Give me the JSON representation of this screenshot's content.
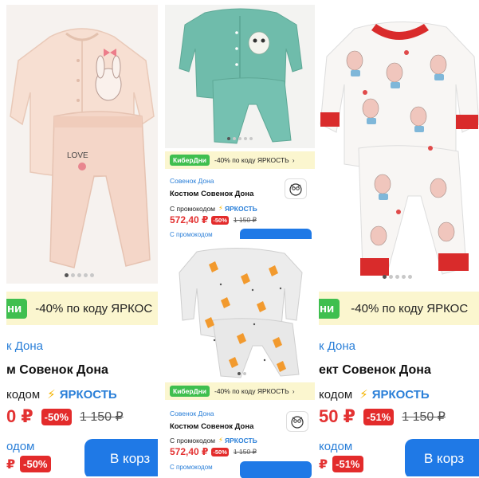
{
  "colors": {
    "accent_blue": "#2a7fd8",
    "button_blue": "#1f79e6",
    "price_red": "#e33232",
    "promo_green": "#3fbf4f",
    "promo_bg": "#fbf6cf"
  },
  "cards": [
    {
      "image_icon": "pajama-pink-bunny-image",
      "promo_tag": "ни",
      "promo_text": "-40% по коду ЯРКОС",
      "brand": "к Дона",
      "title": "м Совенок Дона",
      "promo_prefix": "кодом",
      "promo_code": "ЯРКОСТЬ",
      "price": "0 ₽",
      "discount": "-50%",
      "old_price": "1 150 ₽",
      "promo_line2": "одом",
      "price2": "₽",
      "discount2": "-50%"
    },
    {
      "image_icon": "suit-mint-owl-image",
      "promo_tag": "КиберДни",
      "promo_text": "-40% по коду ЯРКОСТЬ",
      "brand": "Совенок Дона",
      "title": "Костюм Совенок Дона",
      "promo_prefix": "С промокодом",
      "promo_code": "ЯРКОСТЬ",
      "price": "572,40 ₽",
      "discount": "-50%",
      "old_price": "1 150 ₽",
      "promo_line2": "С промокодом"
    },
    {
      "image_icon": "suit-grey-fox-image",
      "promo_tag": "КиберДни",
      "promo_text": "-40% по коду ЯРКОСТЬ",
      "brand": "Совенок Дона",
      "title": "Костюм Совенок Дона",
      "promo_prefix": "С промокодом",
      "promo_code": "ЯРКОСТЬ",
      "price": "572,40 ₽",
      "discount": "-50%",
      "old_price": "1 150 ₽",
      "promo_line2": "С промокодом"
    },
    {
      "image_icon": "pajama-white-bunny-print-image",
      "promo_tag": "ни",
      "promo_text": "-40% по коду ЯРКОС",
      "brand": "к Дона",
      "title": "ект Совенок Дона",
      "promo_prefix": "кодом",
      "promo_code": "ЯРКОСТЬ",
      "price": "50 ₽",
      "discount": "-51%",
      "old_price": "1 150 ₽",
      "promo_line2": "кодом",
      "price2": "₽",
      "discount2": "-51%",
      "cart_label": "В корз"
    },
    {
      "cart_label": "В корз"
    }
  ]
}
